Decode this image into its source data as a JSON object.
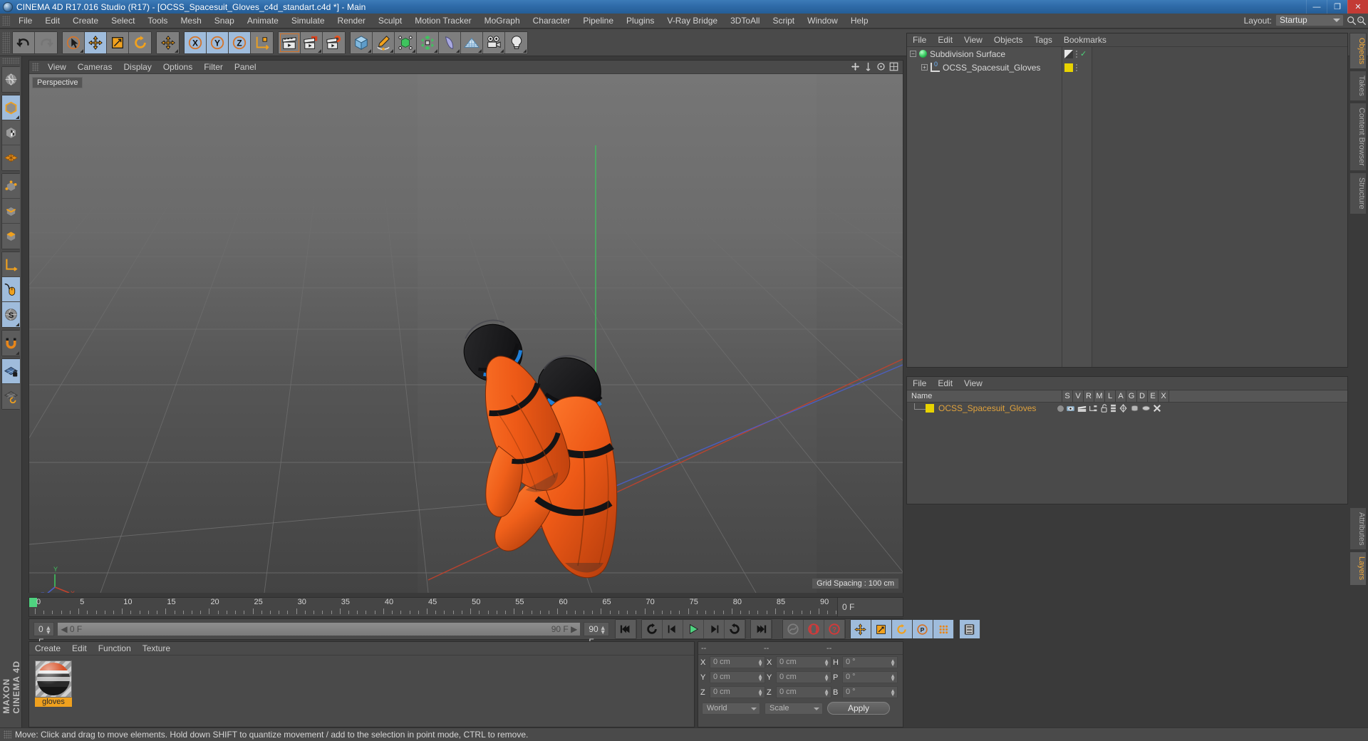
{
  "window": {
    "title": "CINEMA 4D R17.016 Studio (R17) - [OCSS_Spacesuit_Gloves_c4d_standart.c4d *] - Main",
    "minimize": "—",
    "maximize": "❐",
    "close": "✕"
  },
  "menubar": {
    "items": [
      "File",
      "Edit",
      "Create",
      "Select",
      "Tools",
      "Mesh",
      "Snap",
      "Animate",
      "Simulate",
      "Render",
      "Sculpt",
      "Motion Tracker",
      "MoGraph",
      "Character",
      "Pipeline",
      "Plugins",
      "V-Ray Bridge",
      "3DToAll",
      "Script",
      "Window",
      "Help"
    ],
    "layout_label": "Layout:",
    "layout_value": "Startup"
  },
  "toolbar": {
    "icons": [
      "undo-icon",
      "redo-icon",
      "live-selection-icon",
      "move-icon",
      "scale-icon",
      "rotate-icon",
      "move-duplicate-icon",
      "axis-x-icon",
      "axis-y-icon",
      "axis-z-icon",
      "world-object-axis-icon",
      "render-view-icon",
      "render-region-icon",
      "render-settings-icon",
      "cube-primitive-icon",
      "spline-pen-icon",
      "hypernurbs-icon",
      "array-icon",
      "bend-deformer-icon",
      "floor-icon",
      "camera-icon",
      "light-icon"
    ]
  },
  "leftbar": {
    "icons": [
      "make-editable-icon",
      "model-mode-icon",
      "texture-mode-icon",
      "points-mode-icon",
      "edges-mode-icon",
      "polygons-mode-icon",
      "object-axis-icon",
      "workplane-icon",
      "enable-axis-icon",
      "enable-snap-icon",
      "viewport-lock-icon",
      "workplane-lock-icon"
    ],
    "brand_top": "MAXON",
    "brand_bottom": "CINEMA 4D"
  },
  "viewport": {
    "menu": [
      "View",
      "Cameras",
      "Display",
      "Options",
      "Filter",
      "Panel"
    ],
    "label": "Perspective",
    "grid_spacing": "Grid Spacing : 100 cm",
    "axis_labels": {
      "y": "Y",
      "x": "X",
      "z": "Z"
    }
  },
  "object_manager": {
    "menu": [
      "File",
      "Edit",
      "View",
      "Objects",
      "Tags",
      "Bookmarks"
    ],
    "rows": [
      {
        "name": "Subdivision Surface",
        "icon": "subdivision-surface-icon",
        "tag": "diag",
        "visible_check": "✓",
        "indent": 0
      },
      {
        "name": "OCSS_Spacesuit_Gloves",
        "icon": "layer-zero-icon",
        "tag": "yellow",
        "visible_check": "",
        "indent": 1
      }
    ]
  },
  "material_manager_panel": {
    "menu": [
      "File",
      "Edit",
      "View"
    ],
    "columns": [
      "Name",
      "S",
      "V",
      "R",
      "M",
      "L",
      "A",
      "G",
      "D",
      "E",
      "X"
    ],
    "rows": [
      {
        "name": "OCSS_Spacesuit_Gloves",
        "swatch": "#e8d300"
      }
    ]
  },
  "edge_tabs": {
    "top": [
      {
        "label": "Objects",
        "active": true
      },
      {
        "label": "Takes",
        "active": false
      },
      {
        "label": "Content Browser",
        "active": false
      },
      {
        "label": "Structure",
        "active": false
      }
    ],
    "bottom": [
      {
        "label": "Attributes",
        "active": false
      },
      {
        "label": "Layers",
        "active": true
      }
    ]
  },
  "timeline": {
    "ticks": [
      "0",
      "5",
      "10",
      "15",
      "20",
      "25",
      "30",
      "35",
      "40",
      "45",
      "50",
      "55",
      "60",
      "65",
      "70",
      "75",
      "80",
      "85",
      "90"
    ],
    "current_field": "0 F",
    "start_frame": "0 F",
    "range_start": "0 F",
    "range_end": "90 F",
    "end_frame": "90 F",
    "transport_icons": [
      "go-to-start-icon",
      "frame-back-icon",
      "step-back-icon",
      "play-icon",
      "step-forward-icon",
      "loop-icon",
      "go-to-end-icon",
      "record-toggle-icon",
      "autokey-icon",
      "keyframe-help-icon",
      "position-key-icon",
      "scale-key-icon",
      "rotation-key-icon",
      "param-key-icon",
      "pla-key-icon",
      "timeline-icon"
    ]
  },
  "material_manager": {
    "menu": [
      "Create",
      "Edit",
      "Function",
      "Texture"
    ],
    "materials": [
      {
        "name": "gloves"
      }
    ]
  },
  "coordinates": {
    "headers": [
      "--",
      "--",
      "--"
    ],
    "rows": [
      {
        "l1": "X",
        "v1": "0 cm",
        "l2": "X",
        "v2": "0 cm",
        "l3": "H",
        "v3": "0 °"
      },
      {
        "l1": "Y",
        "v1": "0 cm",
        "l2": "Y",
        "v2": "0 cm",
        "l3": "P",
        "v3": "0 °"
      },
      {
        "l1": "Z",
        "v1": "0 cm",
        "l2": "Z",
        "v2": "0 cm",
        "l3": "B",
        "v3": "0 °"
      }
    ],
    "system": "World",
    "mode": "Scale",
    "apply": "Apply"
  },
  "status": {
    "text": "Move: Click and drag to move elements. Hold down SHIFT to quantize movement / add to the selection in point mode, CTRL to remove."
  },
  "colors": {
    "accent_orange": "#f0a11e",
    "title_blue": "#2f6ba8",
    "selected_blue": "#9fbcdc",
    "panel_gray": "#4a4a4a"
  }
}
